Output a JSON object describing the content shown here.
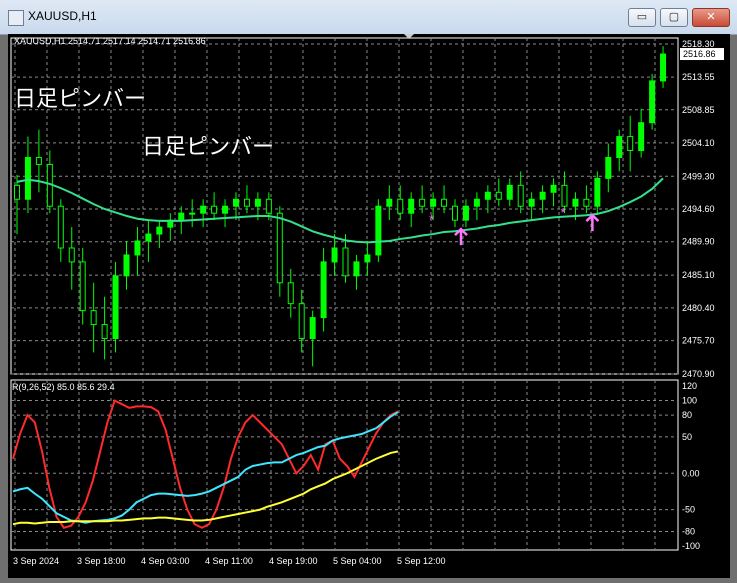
{
  "window": {
    "title": "XAUUSD,H1",
    "minimize": "▭",
    "maximize": "▢",
    "close": "✕"
  },
  "main_header": "XAUUSD,H1  2514.71  2517.14  2514.71  2516.86",
  "indicator_header": "R(9,26,52) 85.0 85.6 29.4",
  "annotations": [
    "日足ピンバー",
    "日足ピンバー"
  ],
  "colors": {
    "bull": "#00ff00",
    "bear": "#000000",
    "ma": "#33e08c",
    "red": "#ff2a2a",
    "cyan": "#3fe6ff",
    "yellow": "#ffff33",
    "arrow": "#ff77ff"
  },
  "chart_data": [
    {
      "type": "candlestick",
      "y_ticks": [
        "2518.30",
        "2513.55",
        "2508.85",
        "2504.10",
        "2499.30",
        "2494.60",
        "2489.90",
        "2485.10",
        "2480.40",
        "2475.70",
        "2470.90"
      ],
      "current_price": "2516.86",
      "ylim": [
        2470.9,
        2518.3
      ],
      "candles": [
        [
          2498,
          2499.5,
          2491,
          2496
        ],
        [
          2496,
          2505,
          2494,
          2502
        ],
        [
          2502,
          2506,
          2497,
          2501
        ],
        [
          2501,
          2503,
          2494,
          2495
        ],
        [
          2495,
          2496,
          2487,
          2489
        ],
        [
          2489,
          2492,
          2483,
          2487
        ],
        [
          2487,
          2489,
          2478,
          2480
        ],
        [
          2480,
          2484,
          2474,
          2478
        ],
        [
          2478,
          2482,
          2473,
          2476
        ],
        [
          2476,
          2487,
          2474,
          2485
        ],
        [
          2485,
          2490,
          2483,
          2488
        ],
        [
          2488,
          2492,
          2485,
          2490
        ],
        [
          2490,
          2493,
          2487,
          2491
        ],
        [
          2491,
          2493,
          2489,
          2492
        ],
        [
          2492,
          2494,
          2490,
          2493
        ],
        [
          2493,
          2495,
          2491,
          2494
        ],
        [
          2494,
          2496,
          2492,
          2494
        ],
        [
          2494,
          2496,
          2492,
          2495
        ],
        [
          2495,
          2497,
          2493,
          2494
        ],
        [
          2494,
          2496,
          2492,
          2495
        ],
        [
          2495,
          2497,
          2493,
          2496
        ],
        [
          2496,
          2498,
          2494,
          2495
        ],
        [
          2495,
          2497,
          2493,
          2496
        ],
        [
          2496,
          2497,
          2493,
          2494
        ],
        [
          2494,
          2495,
          2482,
          2484
        ],
        [
          2484,
          2486,
          2479,
          2481
        ],
        [
          2481,
          2483,
          2474,
          2476
        ],
        [
          2476,
          2480,
          2472,
          2479
        ],
        [
          2479,
          2489,
          2477,
          2487
        ],
        [
          2487,
          2491,
          2485,
          2489
        ],
        [
          2489,
          2491,
          2484,
          2485
        ],
        [
          2485,
          2488,
          2483,
          2487
        ],
        [
          2487,
          2490,
          2485,
          2488
        ],
        [
          2488,
          2496,
          2487,
          2495
        ],
        [
          2495,
          2498,
          2493,
          2496
        ],
        [
          2496,
          2498,
          2493,
          2494
        ],
        [
          2494,
          2497,
          2492,
          2496
        ],
        [
          2496,
          2498,
          2494,
          2495
        ],
        [
          2495,
          2497,
          2493,
          2496
        ],
        [
          2496,
          2498,
          2494,
          2495
        ],
        [
          2495,
          2496,
          2492,
          2493
        ],
        [
          2493,
          2496,
          2492,
          2495
        ],
        [
          2495,
          2497,
          2493,
          2496
        ],
        [
          2496,
          2498,
          2494,
          2497
        ],
        [
          2497,
          2499,
          2495,
          2496
        ],
        [
          2496,
          2499,
          2495,
          2498
        ],
        [
          2498,
          2500,
          2494,
          2495
        ],
        [
          2495,
          2497,
          2493,
          2496
        ],
        [
          2496,
          2498,
          2494,
          2497
        ],
        [
          2497,
          2499,
          2495,
          2498
        ],
        [
          2498,
          2500,
          2494,
          2495
        ],
        [
          2495,
          2497,
          2493,
          2496
        ],
        [
          2496,
          2498,
          2494,
          2495
        ],
        [
          2495,
          2500,
          2494,
          2499
        ],
        [
          2499,
          2504,
          2497,
          2502
        ],
        [
          2502,
          2506,
          2500,
          2505
        ],
        [
          2505,
          2508,
          2500,
          2503
        ],
        [
          2503,
          2509,
          2502,
          2507
        ],
        [
          2507,
          2514,
          2506,
          2513
        ],
        [
          2513,
          2518,
          2512,
          2516.86
        ]
      ],
      "ma": [
        2498.5,
        2498.8,
        2498.6,
        2498.2,
        2497.6,
        2496.9,
        2496.1,
        2495.3,
        2494.6,
        2494.1,
        2493.6,
        2493.2,
        2493.0,
        2492.9,
        2492.9,
        2492.9,
        2493.0,
        2493.1,
        2493.2,
        2493.3,
        2493.4,
        2493.5,
        2493.6,
        2493.6,
        2493.3,
        2492.8,
        2492.1,
        2491.4,
        2490.9,
        2490.5,
        2490.1,
        2489.9,
        2489.8,
        2489.9,
        2490.0,
        2490.3,
        2490.5,
        2490.8,
        2491.0,
        2491.3,
        2491.4,
        2491.6,
        2491.8,
        2492.1,
        2492.3,
        2492.6,
        2492.8,
        2493.0,
        2493.2,
        2493.4,
        2493.5,
        2493.6,
        2493.7,
        2493.9,
        2494.3,
        2494.9,
        2495.6,
        2496.4,
        2497.5,
        2499.0
      ],
      "arrows": [
        40,
        52
      ],
      "stars": [
        38,
        50
      ]
    },
    {
      "type": "line",
      "y_ticks": [
        "120",
        "100",
        "80",
        "50",
        "0.00",
        "-50",
        "-80",
        "-100"
      ],
      "ylim": [
        -100,
        120
      ],
      "series": [
        {
          "color_key": "red",
          "values": [
            20,
            55,
            80,
            70,
            30,
            -20,
            -60,
            -75,
            -72,
            -60,
            -40,
            -10,
            30,
            70,
            100,
            95,
            90,
            92,
            92,
            91,
            85,
            60,
            20,
            -20,
            -50,
            -70,
            -75,
            -70,
            -50,
            -20,
            20,
            50,
            70,
            80,
            70,
            60,
            50,
            40,
            20,
            0,
            10,
            25,
            5,
            40,
            45,
            20,
            10,
            -5,
            15,
            35,
            55,
            70,
            80,
            85
          ]
        },
        {
          "color_key": "cyan",
          "values": [
            -25,
            -22,
            -20,
            -28,
            -35,
            -45,
            -55,
            -60,
            -65,
            -66,
            -68,
            -66,
            -65,
            -64,
            -62,
            -58,
            -50,
            -40,
            -35,
            -30,
            -28,
            -28,
            -29,
            -30,
            -31,
            -30,
            -28,
            -25,
            -20,
            -15,
            -10,
            -5,
            5,
            10,
            12,
            14,
            15,
            15,
            20,
            25,
            28,
            32,
            36,
            38,
            45,
            48,
            50,
            52,
            54,
            58,
            62,
            70,
            78,
            84
          ]
        },
        {
          "color_key": "yellow",
          "values": [
            -70,
            -68,
            -68,
            -69,
            -68,
            -67,
            -67,
            -67,
            -66,
            -66,
            -66,
            -66,
            -66,
            -66,
            -65,
            -65,
            -64,
            -63,
            -62,
            -62,
            -61,
            -61,
            -62,
            -63,
            -64,
            -65,
            -65,
            -64,
            -62,
            -60,
            -58,
            -56,
            -54,
            -52,
            -50,
            -46,
            -43,
            -40,
            -36,
            -32,
            -28,
            -22,
            -18,
            -14,
            -8,
            -4,
            0,
            5,
            10,
            15,
            20,
            24,
            28,
            30
          ]
        }
      ]
    }
  ],
  "x_labels": [
    "3 Sep 2024",
    "3 Sep 18:00",
    "4 Sep 03:00",
    "4 Sep 11:00",
    "4 Sep 19:00",
    "5 Sep 04:00",
    "5 Sep 12:00"
  ]
}
